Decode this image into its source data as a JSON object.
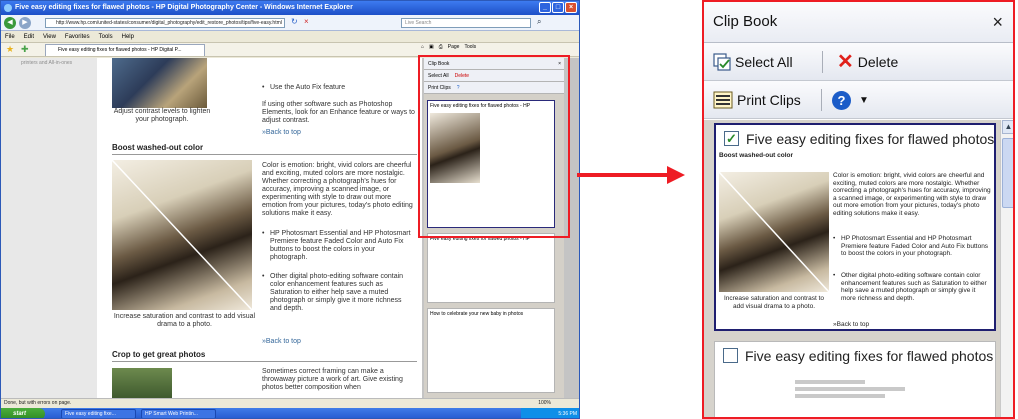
{
  "browser": {
    "window_title": "Five easy editing fixes for flawed photos - HP Digital Photography Center - Windows Internet Explorer",
    "url": "http://www.hp.com/united-states/consumer/digital_photography/edit_restore_photos/tips/five-easy.html",
    "search_placeholder": "Live Search",
    "menu": [
      "File",
      "Edit",
      "View",
      "Favorites",
      "Tools",
      "Help"
    ],
    "tab_title": "Five easy editing fixes for flawed photos - HP Digital P...",
    "left_nav_text": "printers and All-in-ones",
    "status_text": "Done, but with errors on page.",
    "zoom": "100%",
    "start": "start",
    "taskbar_items": [
      "Five easy editing fixe...",
      "HP Smart Web Printin..."
    ],
    "clock": "5:36 PM"
  },
  "article": {
    "bullet_autofix": "Use the Auto Fix feature",
    "para_other_software": "If using other software such as Photoshop Elements, look for an Enhance feature or ways to adjust contrast.",
    "caption_contrast": "Adjust contrast levels to lighten your photograph.",
    "back_to_top": "»Back to top",
    "heading_washed": "Boost washed-out color",
    "para_color": "Color is emotion: bright, vivid colors are cheerful and exciting, muted colors are more nostalgic. Whether correcting a photograph's hues for accuracy, improving a scanned image, or experimenting with style to draw out more emotion from your pictures, today's photo editing solutions make it easy.",
    "bullet_faded": "HP Photosmart Essential and HP Photosmart Premiere feature Faded Color and Auto Fix buttons to boost the colors in your photograph.",
    "bullet_other": "Other digital photo-editing software contain color enhancement features such as Saturation to either help save a muted photograph or simply give it more richness and depth.",
    "caption_saturation": "Increase saturation and contrast to add visual drama to a photo.",
    "heading_crop": "Crop to get great photos",
    "para_crop": "Sometimes correct framing can make a throwaway picture a work of art. Give existing photos better composition when"
  },
  "clipbook": {
    "title": "Clip Book",
    "close": "×",
    "select_all": "Select All",
    "delete": "Delete",
    "print_clips": "Print Clips",
    "clips": [
      {
        "title": "Five easy editing fixes for flawed photos - HP",
        "checked": true
      },
      {
        "title": "Five easy editing fixes for flawed photos - HP",
        "checked": false
      },
      {
        "title": "How to celebrate your new baby in photos",
        "checked": false
      }
    ],
    "clip_heading": "Boost washed-out color",
    "clip_back": "»Back to top"
  },
  "mini_toolbar": {
    "page": "Page",
    "tools": "Tools"
  },
  "colors": {
    "highlight_red": "#ee1c24",
    "hp_blue": "#336699",
    "xp_blue": "#2457cf"
  }
}
